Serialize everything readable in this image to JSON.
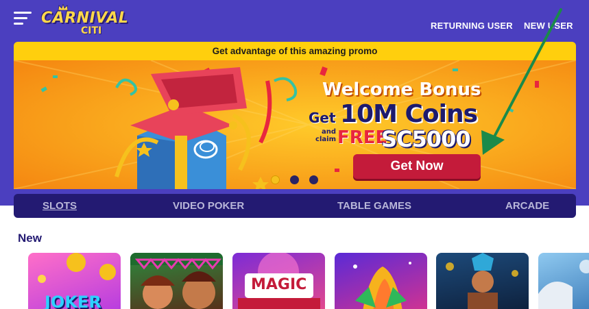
{
  "header": {
    "logo_line1": "CARNIVAL",
    "logo_line2": "CITI",
    "returning_user": "RETURNING USER",
    "new_user": "NEW USER"
  },
  "promo": {
    "bar_text": "Get advantage of this amazing promo",
    "welcome": "Welcome Bonus",
    "get_small": "Get",
    "get_big": "10M Coins",
    "claim_small": "and claim",
    "claim_free": "FREE",
    "claim_amount": "SC5000",
    "cta": "Get Now",
    "carousel_active_index": 0,
    "carousel_count": 3
  },
  "tabs": [
    {
      "label": "SLOTS",
      "active": true
    },
    {
      "label": "VIDEO POKER",
      "active": false
    },
    {
      "label": "TABLE GAMES",
      "active": false
    },
    {
      "label": "ARCADE",
      "active": false
    }
  ],
  "section": {
    "title": "New"
  },
  "games": [
    {
      "title": "JOKER"
    },
    {
      "title": ""
    },
    {
      "title": "MAGIC"
    },
    {
      "title": ""
    },
    {
      "title": ""
    },
    {
      "title": ""
    }
  ],
  "colors": {
    "header_bg": "#4b3fbf",
    "promo_bar": "#ffcf0d",
    "banner_bg": "#f7a21b",
    "cta_bg": "#c41b3a",
    "tabs_bg": "#231a72",
    "arrow": "#1a8a4a"
  }
}
